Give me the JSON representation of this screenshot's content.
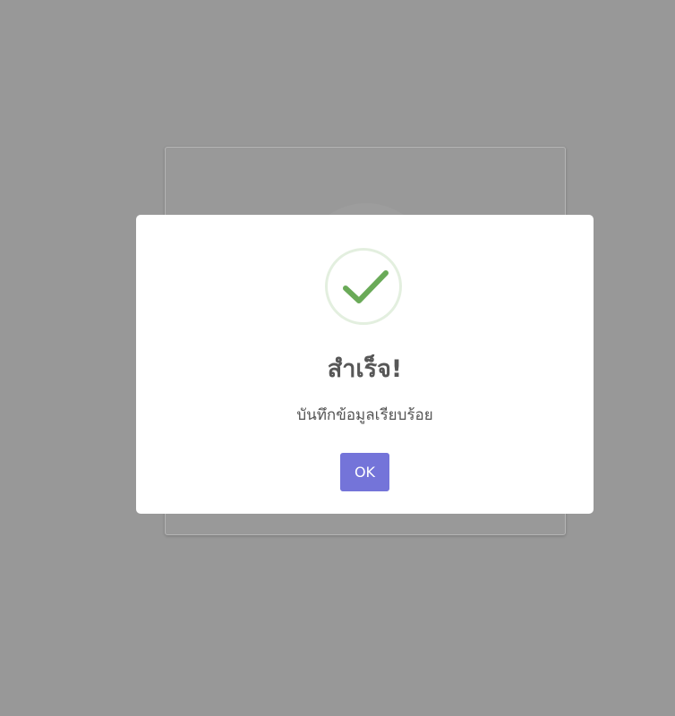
{
  "dialog": {
    "icon": "check-icon",
    "title": "สำเร็จ!",
    "message": "บันทึกข้อมูลเรียบร้อย",
    "confirm_label": "OK"
  },
  "colors": {
    "backdrop": "#989898",
    "confirm_button": "#7474d9",
    "success_check": "#6aaa58",
    "success_ring": "#e3efdf"
  }
}
